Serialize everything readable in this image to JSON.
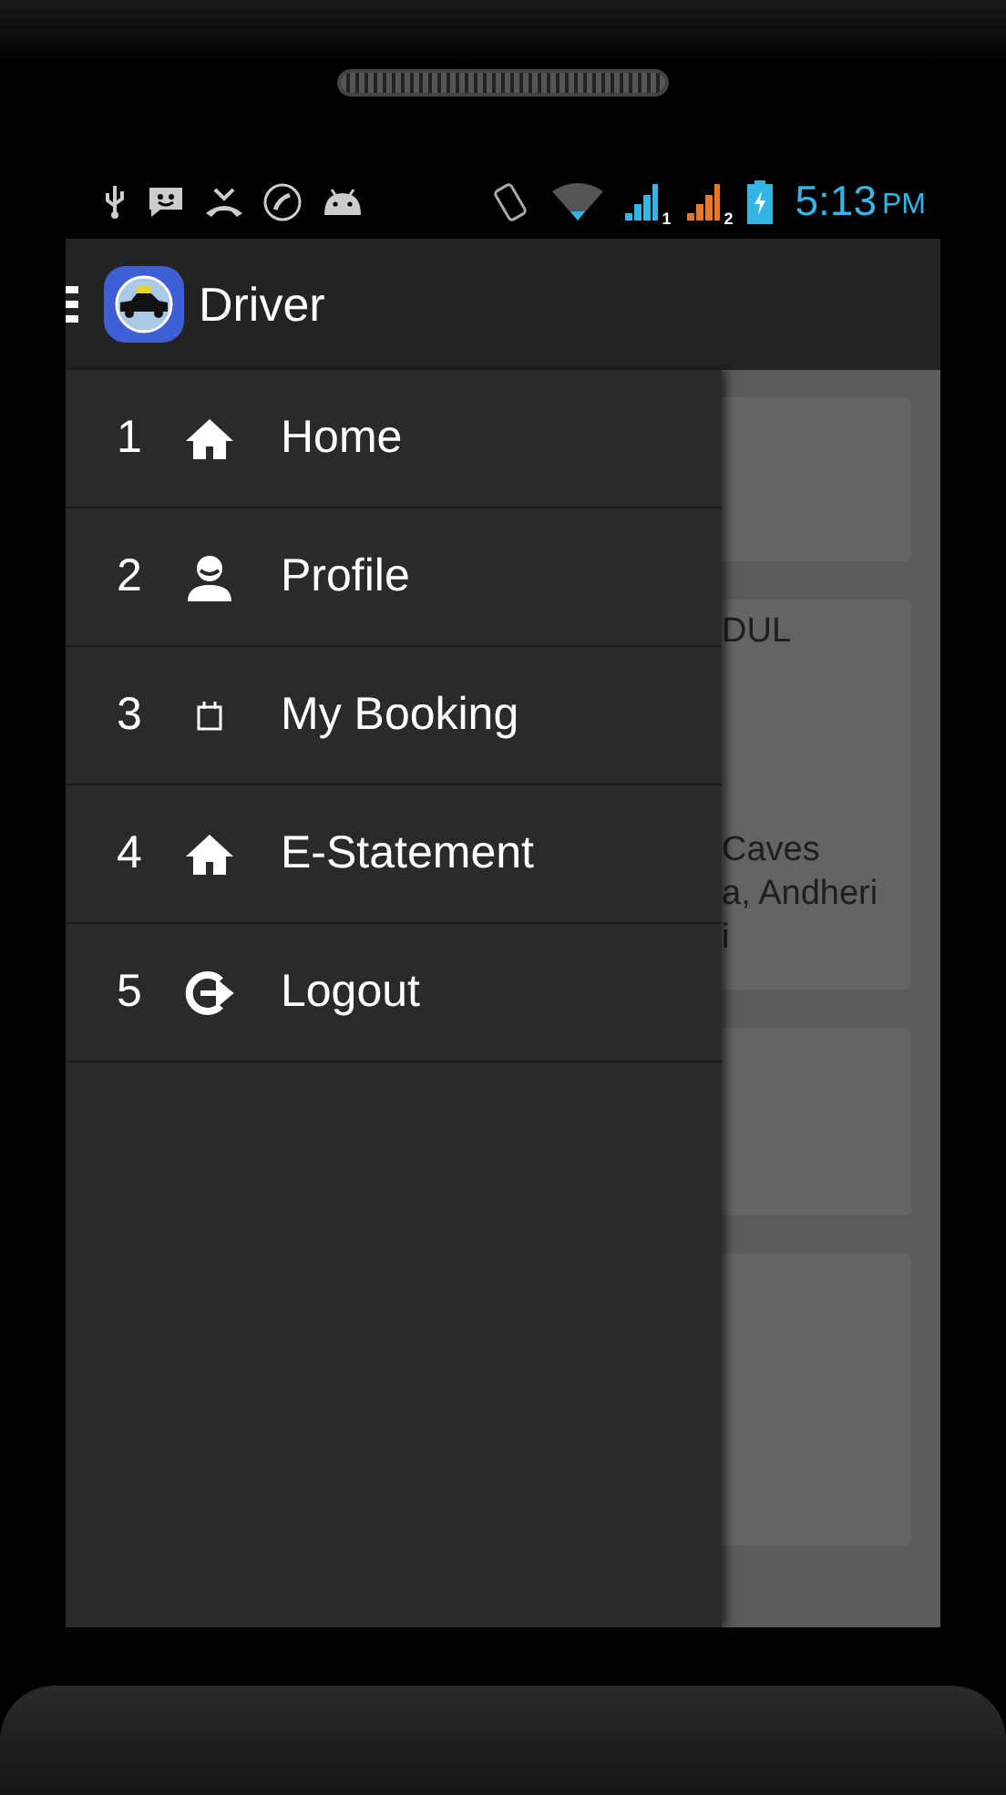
{
  "status_bar": {
    "sim_labels": [
      "1",
      "2"
    ],
    "time": "5:13",
    "period": "PM"
  },
  "action_bar": {
    "title": "Driver"
  },
  "drawer": {
    "items": [
      {
        "number": "1",
        "kind": "home",
        "label": "Home"
      },
      {
        "number": "2",
        "kind": "person",
        "label": "Profile"
      },
      {
        "number": "3",
        "kind": "calendar",
        "label": "My Booking"
      },
      {
        "number": "4",
        "kind": "home",
        "label": "E-Statement"
      },
      {
        "number": "5",
        "kind": "logout",
        "label": "Logout"
      }
    ]
  },
  "content_card": {
    "heading": "DUL",
    "address": [
      "Caves",
      "a, Andheri",
      "i"
    ]
  }
}
